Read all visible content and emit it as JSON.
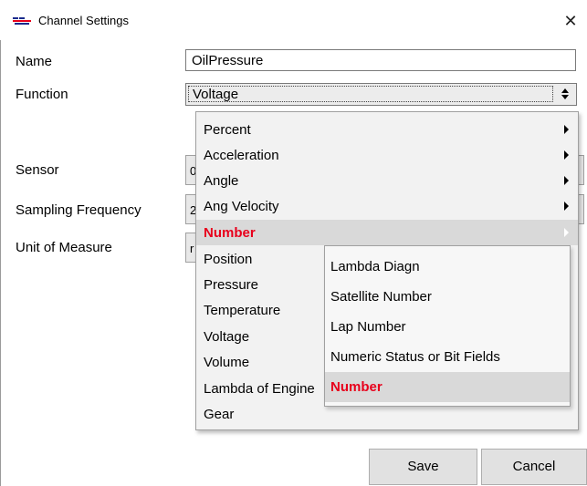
{
  "window": {
    "title": "Channel Settings",
    "close_glyph": "✕"
  },
  "form": {
    "name_label": "Name",
    "name_value": "OilPressure",
    "function_label": "Function",
    "function_value": "Voltage",
    "sensor_label": "Sensor",
    "sampling_label": "Sampling Frequency",
    "unit_label": "Unit of Measure",
    "sensor_peek": "0",
    "sampling_peek": "2",
    "unit_peek": "r"
  },
  "menu": {
    "items": [
      {
        "label": "Percent",
        "has_submenu": true
      },
      {
        "label": "Acceleration",
        "has_submenu": true
      },
      {
        "label": "Angle",
        "has_submenu": true
      },
      {
        "label": "Ang Velocity",
        "has_submenu": true
      },
      {
        "label": "Number",
        "has_submenu": true,
        "highlighted": true
      },
      {
        "label": "Position",
        "has_submenu": false
      },
      {
        "label": "Pressure",
        "has_submenu": false
      },
      {
        "label": "Temperature",
        "has_submenu": false
      },
      {
        "label": "Voltage",
        "has_submenu": false
      },
      {
        "label": "Volume",
        "has_submenu": false
      },
      {
        "label": "Lambda of Engine",
        "has_submenu": false
      },
      {
        "label": "Gear",
        "has_submenu": false
      }
    ]
  },
  "submenu": {
    "items": [
      {
        "label": "Lambda Diagn"
      },
      {
        "label": "Satellite Number"
      },
      {
        "label": "Lap Number"
      },
      {
        "label": "Numeric Status or Bit Fields"
      },
      {
        "label": "Number",
        "highlighted": true
      }
    ]
  },
  "buttons": {
    "save": "Save",
    "cancel": "Cancel"
  },
  "colors": {
    "highlight_text": "#e8001c",
    "highlight_bg": "#d9d9d9",
    "menu_bg": "#f2f2f2"
  },
  "icons": {
    "app": "aim-logo-icon",
    "close": "close-icon",
    "dropdown": "updown-arrows-icon",
    "submenu": "submenu-arrow-icon"
  }
}
